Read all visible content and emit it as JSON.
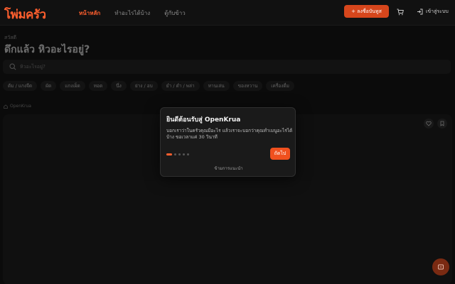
{
  "header": {
    "logo": "โพ่มครัว",
    "nav": [
      {
        "label": "หน้าหลัก",
        "active": true
      },
      {
        "label": "ทำอะไรได้บ้าง",
        "active": false
      },
      {
        "label": "ตู้กับข้าว",
        "active": false
      }
    ],
    "signup_label": "+  ลงชื่อบันทูส",
    "login_label": "เข้าสู่ระบบ"
  },
  "page": {
    "greeting": "สวัสดี",
    "title": "ดึกแล้ว หิวอะไรอยู่?",
    "search_placeholder": "หิวอะไรอยู่?",
    "chips": [
      "ต้ม / แกงจืด",
      "ผัด",
      "แกงเผ็ด",
      "ทอด",
      "นึ่ง",
      "ย่าง / อบ",
      "ยำ / ตำ / พล่า",
      "ทานเล่น",
      "ของหวาน",
      "เครื่องดื่ม"
    ],
    "source": "OpenKrua"
  },
  "modal": {
    "title": "ยินดีต้อนรับสู่ OpenKrua",
    "body": "บอกเราว่าในครัวคุณมีอะไร แล้วเราจะบอกว่าคุณทำเมนูอะไรได้บ้าง ขอเวลาแค่ 30 วินาที",
    "next_label": "ถัดไป",
    "skip_label": "ข้ามการแนะนำ",
    "steps_total": 5,
    "step_current": 1
  },
  "colors": {
    "accent": "#ff5f2e",
    "background": "#0b0b0b"
  }
}
